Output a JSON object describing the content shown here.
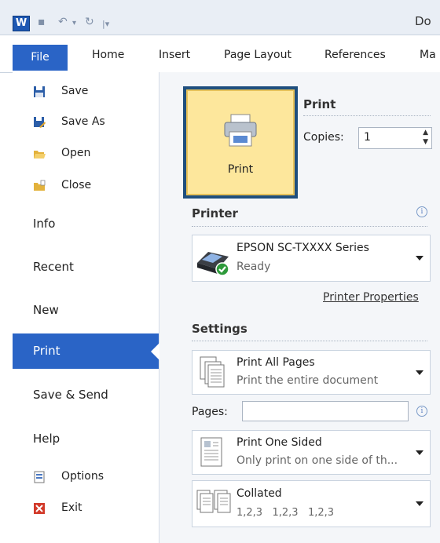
{
  "titlebar": {
    "app_icon": "W",
    "title": "Do"
  },
  "tabs": [
    {
      "label": "File"
    },
    {
      "label": "Home"
    },
    {
      "label": "Insert"
    },
    {
      "label": "Page Layout"
    },
    {
      "label": "References"
    },
    {
      "label": "Ma"
    }
  ],
  "nav": {
    "save": "Save",
    "save_as": "Save As",
    "open": "Open",
    "close": "Close",
    "info": "Info",
    "recent": "Recent",
    "new": "New",
    "print": "Print",
    "save_send": "Save & Send",
    "help": "Help",
    "options": "Options",
    "exit": "Exit"
  },
  "print_panel": {
    "print_button_label": "Print",
    "print_heading": "Print",
    "copies_label": "Copies:",
    "copies_value": "1"
  },
  "printer": {
    "heading": "Printer",
    "name": "EPSON SC-TXXXX Series",
    "status": "Ready",
    "properties_link": "Printer Properties"
  },
  "settings": {
    "heading": "Settings",
    "pages_dd": {
      "main": "Print All Pages",
      "sub": "Print the entire document"
    },
    "pages_label": "Pages:",
    "pages_value": "",
    "sided_dd": {
      "main": "Print One Sided",
      "sub": "Only print on one side of th..."
    },
    "collate_dd": {
      "main": "Collated",
      "sub": "1,2,3   1,2,3   1,2,3"
    }
  },
  "colors": {
    "accent": "#2a64c6",
    "print_button": "#fde79c",
    "highlight_border": "#1f4f7e"
  }
}
